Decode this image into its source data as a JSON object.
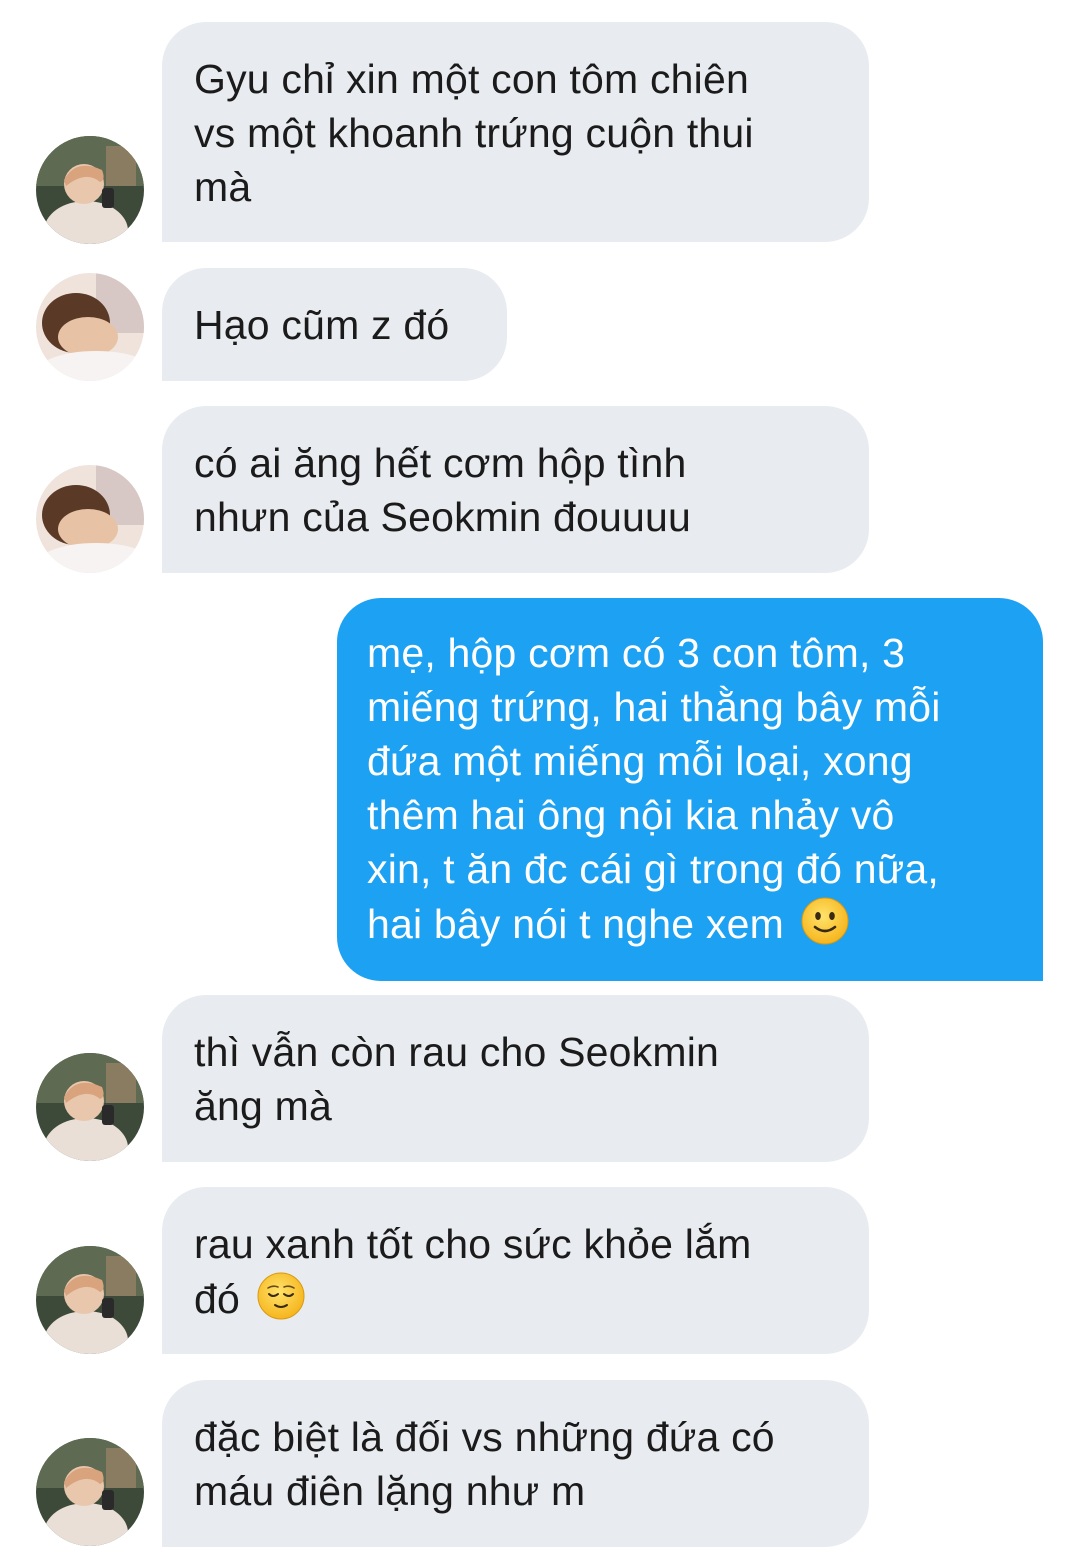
{
  "messages": [
    {
      "id": 1,
      "side": "in",
      "text": "Gyu chỉ xin một con tôm chiên\nvs một khoanh trứng cuộn thui\nmà",
      "avatar": "avatar-gyu"
    },
    {
      "id": 2,
      "side": "in",
      "text": "Hạo cũm z đó",
      "avatar": "avatar-hao"
    },
    {
      "id": 3,
      "side": "in",
      "text": "có ai ăng hết cơm hộp tình\nnhưn của Seokmin đouuuu",
      "avatar": "avatar-hao"
    },
    {
      "id": 4,
      "side": "out",
      "text": "mẹ, hộp cơm có 3 con tôm, 3\nmiếng trứng, hai thằng bây mỗi\nđứa một miếng mỗi loại, xong\nthêm hai ông nội kia nhảy vô\nxin, t ăn đc cái gì trong đó nữa,\nhai bây nói t nghe xem",
      "emoji": "slightly-smiling-face"
    },
    {
      "id": 5,
      "side": "in",
      "text": "thì vẫn còn rau cho Seokmin\năng mà",
      "avatar": "avatar-gyu"
    },
    {
      "id": 6,
      "side": "in",
      "text": "rau xanh tốt cho sức khỏe lắm\nđó",
      "emoji": "relieved-face",
      "avatar": "avatar-gyu"
    },
    {
      "id": 7,
      "side": "in",
      "text": "đặc biệt là đối vs những đứa có\nmáu điên lặng như m",
      "avatar": "avatar-gyu"
    }
  ],
  "colors": {
    "incoming_bubble": "#e8ebef",
    "outgoing_bubble": "#1da1f2",
    "incoming_text": "#1b1b1b",
    "outgoing_text": "#ffffff"
  }
}
